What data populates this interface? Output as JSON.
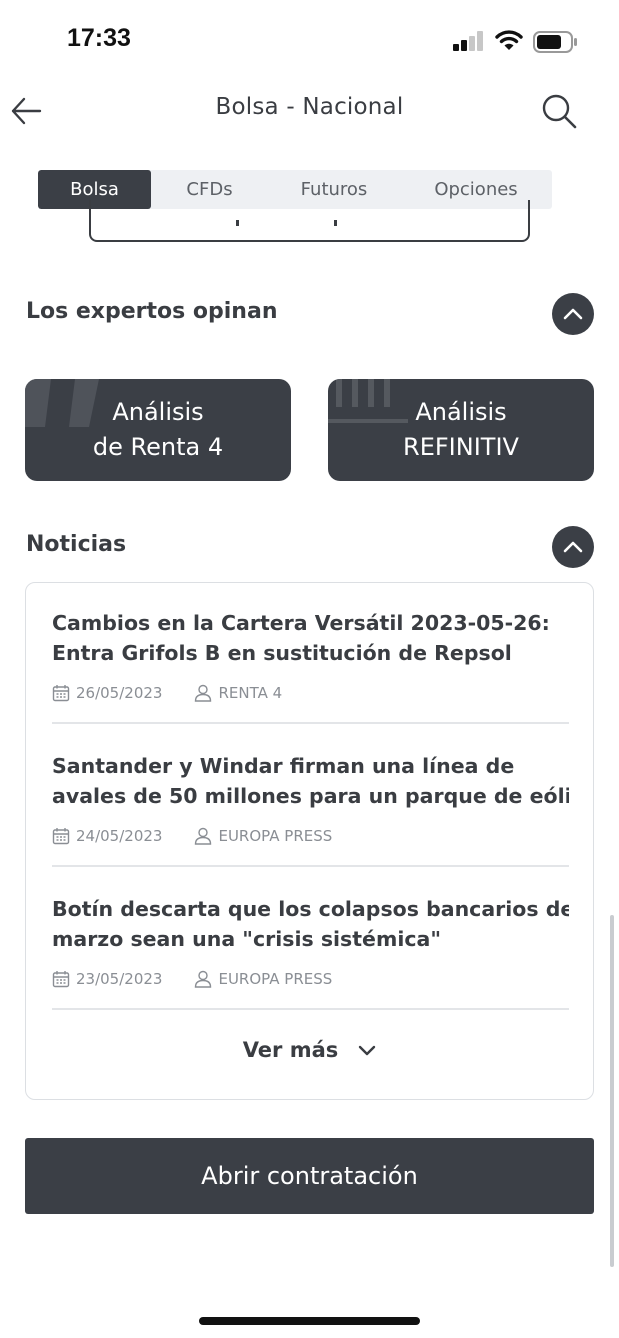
{
  "status_bar": {
    "time": "17:33"
  },
  "header": {
    "title": "Bolsa - Nacional"
  },
  "tabs": [
    {
      "label": "Bolsa",
      "active": true
    },
    {
      "label": "CFDs",
      "active": false
    },
    {
      "label": "Futuros",
      "active": false
    },
    {
      "label": "Opciones",
      "active": false
    }
  ],
  "experts": {
    "title": "Los expertos opinan",
    "cards": [
      {
        "line1": "Análisis",
        "line2": "de Renta 4"
      },
      {
        "line1": "Análisis",
        "line2": "REFINITIV"
      }
    ]
  },
  "news": {
    "title": "Noticias",
    "items": [
      {
        "title_line1": "Cambios en la Cartera Versátil 2023-05-26:",
        "title_line2": "Entra Grifols B en sustitución de Repsol",
        "date": "26/05/2023",
        "source": "RENTA 4"
      },
      {
        "title_line1": "Santander y Windar firman una línea de",
        "title_line2": "avales de 50 millones para un parque de eóli...",
        "date": "24/05/2023",
        "source": "EUROPA PRESS"
      },
      {
        "title_line1": "Botín descarta que los colapsos bancarios de",
        "title_line2": "marzo sean una \"crisis sistémica\"",
        "date": "23/05/2023",
        "source": "EUROPA PRESS"
      }
    ],
    "more_label": "Ver más"
  },
  "primary_button": {
    "label": "Abrir contratación"
  },
  "colors": {
    "dark": "#3b3f46",
    "text": "#3a3d42",
    "muted": "#8a8e94",
    "tab_bg": "#eef0f3"
  }
}
